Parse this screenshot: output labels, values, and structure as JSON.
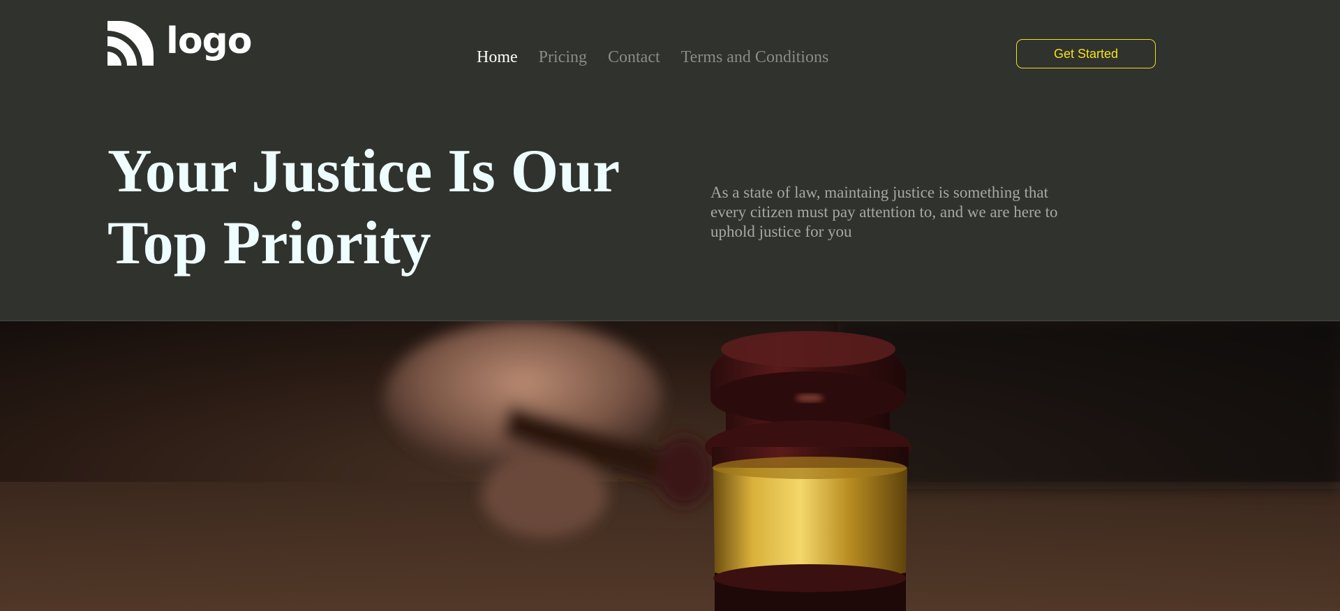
{
  "header": {
    "logo_text": "logo",
    "nav": [
      {
        "label": "Home",
        "active": true
      },
      {
        "label": "Pricing",
        "active": false
      },
      {
        "label": "Contact",
        "active": false
      },
      {
        "label": "Terms and Conditions",
        "active": false
      }
    ],
    "cta_label": "Get Started"
  },
  "hero": {
    "title": "Your Justice Is Our Top Priority",
    "description": "As a state of law, maintaing justice is something that every citizen must pay attention to, and we are here to uphold justice for you"
  },
  "image": {
    "subject": "gavel-photo"
  },
  "colors": {
    "background": "#30322d",
    "accent": "#f3e21f",
    "title": "#eefdfd",
    "muted_text": "#a7a8a2",
    "nav_inactive": "#8a8b86"
  }
}
